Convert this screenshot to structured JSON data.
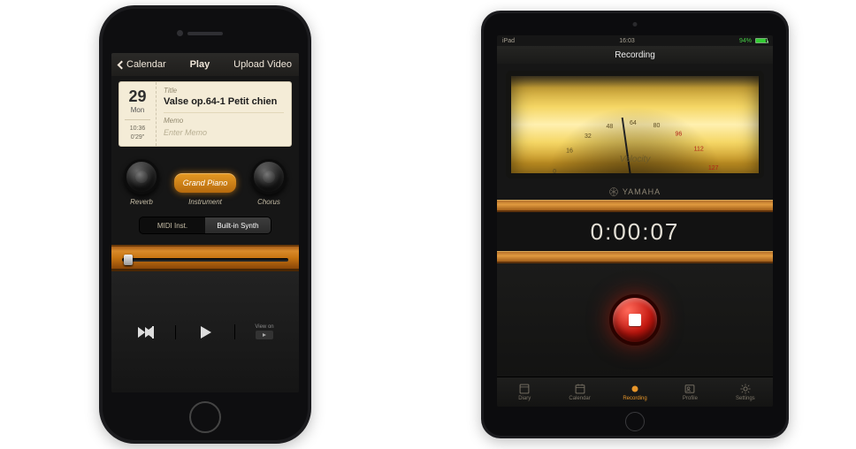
{
  "phone": {
    "nav": {
      "back": "Calendar",
      "title": "Play",
      "right": "Upload Video"
    },
    "card": {
      "date_number": "29",
      "day_of_week": "Mon",
      "time": "10:36",
      "duration": "0'29\"",
      "title_label": "Title",
      "title_value": "Valse op.64-1 Petit chien",
      "memo_label": "Memo",
      "memo_placeholder": "Enter Memo"
    },
    "knobs": {
      "reverb": "Reverb",
      "instrument_btn": "Grand Piano",
      "instrument_label": "Instrument",
      "chorus": "Chorus"
    },
    "segment": {
      "midi": "MIDI Inst.",
      "synth": "Built-in Synth"
    },
    "transport": {
      "view_on": "View on",
      "youtube": "YouTube"
    }
  },
  "pad": {
    "status": {
      "carrier": "iPad",
      "wifi": "ᯤ",
      "time": "16:03",
      "battery": "94%"
    },
    "nav_title": "Recording",
    "meter": {
      "label": "Velocity",
      "ticks": [
        "0",
        "16",
        "32",
        "48",
        "64",
        "80",
        "96",
        "112",
        "127"
      ],
      "red_from": 96
    },
    "brand": "YAMAHA",
    "timer": "0:00:07",
    "tabs": [
      {
        "name": "diary",
        "label": "Diary"
      },
      {
        "name": "calendar",
        "label": "Calendar"
      },
      {
        "name": "recording",
        "label": "Recording"
      },
      {
        "name": "profile",
        "label": "Profile"
      },
      {
        "name": "settings",
        "label": "Settings"
      }
    ]
  },
  "colors": {
    "accent": "#e6952a",
    "record": "#c4170f"
  }
}
